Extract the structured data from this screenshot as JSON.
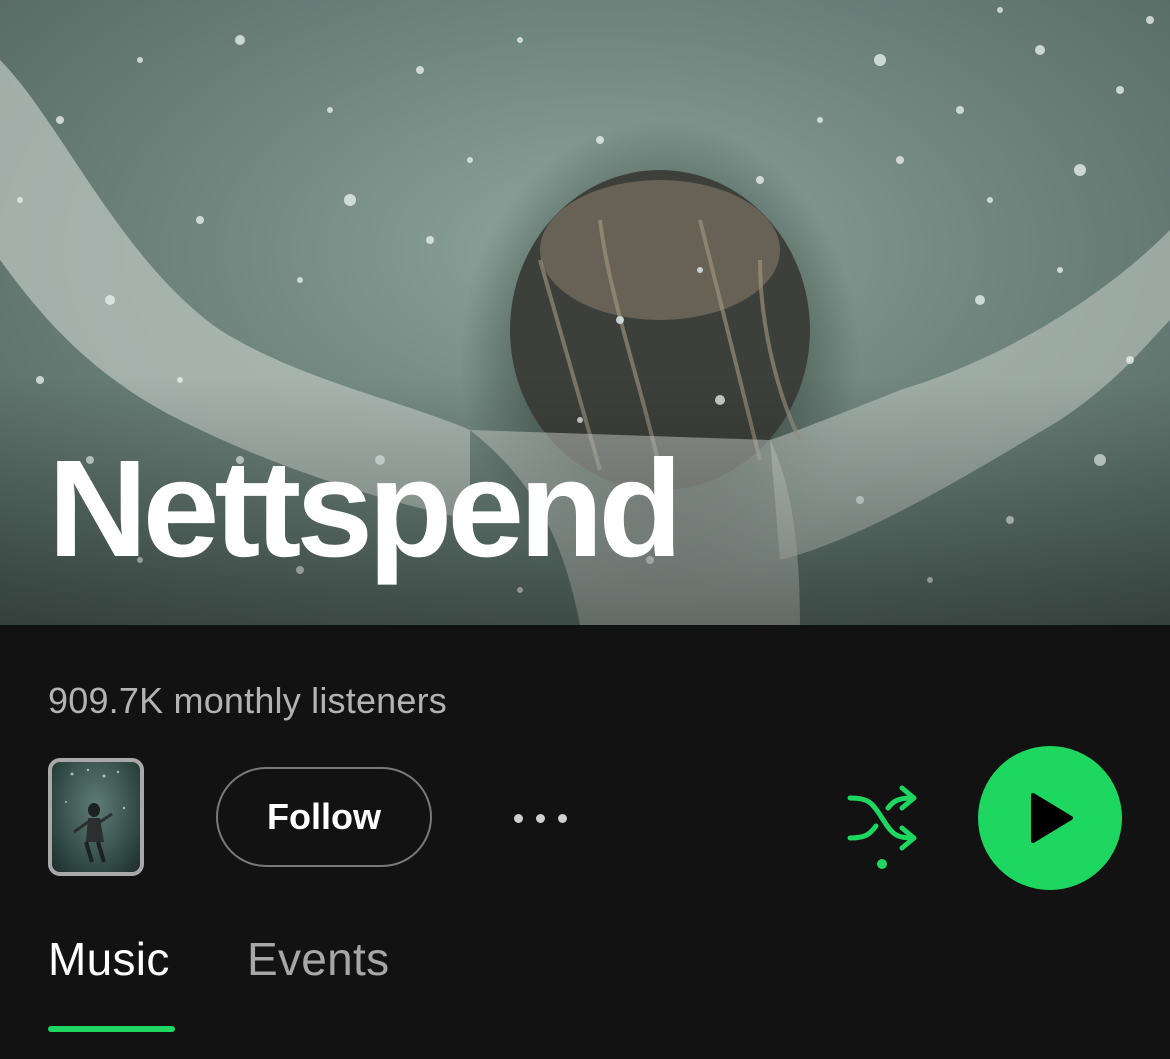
{
  "artist": {
    "name": "Nettspend",
    "monthly_listeners": "909.7K monthly listeners"
  },
  "actions": {
    "follow_label": "Follow",
    "more_icon": "more-horizontal-icon",
    "shuffle_icon": "shuffle-icon",
    "play_icon": "play-icon"
  },
  "tabs": [
    {
      "label": "Music",
      "selected": true
    },
    {
      "label": "Events",
      "selected": false
    }
  ],
  "colors": {
    "accent": "#1ed760",
    "background": "#121212",
    "secondary_text": "#b3b3b3"
  }
}
